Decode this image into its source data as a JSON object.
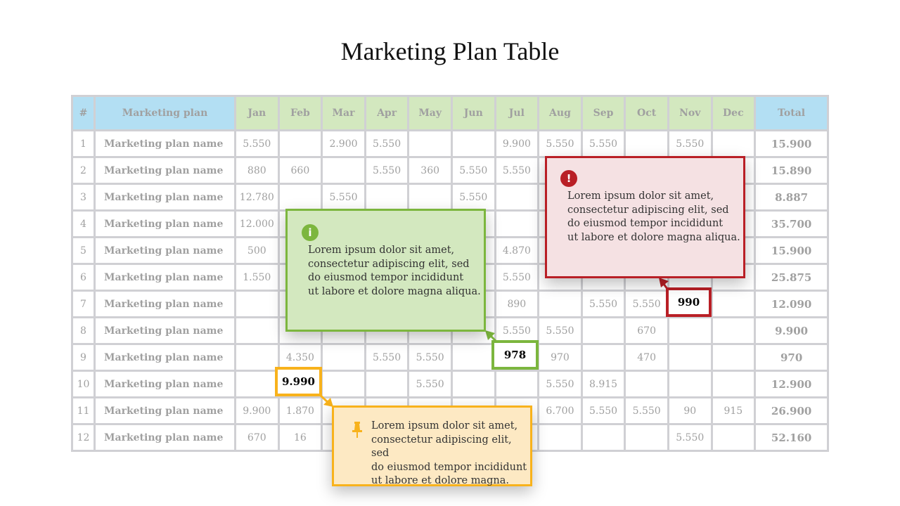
{
  "title": "Marketing Plan Table",
  "table": {
    "headers": [
      "#",
      "Marketing plan",
      "Jan",
      "Feb",
      "Mar",
      "Apr",
      "May",
      "Jun",
      "Jul",
      "Aug",
      "Sep",
      "Oct",
      "Nov",
      "Dec",
      "Total"
    ],
    "rows": [
      [
        "1",
        "Marketing plan name",
        "5.550",
        "",
        "2.900",
        "5.550",
        "",
        "",
        "9.900",
        "5.550",
        "5.550",
        "",
        "5.550",
        "",
        "15.900"
      ],
      [
        "2",
        "Marketing plan name",
        "880",
        "660",
        "",
        "5.550",
        "360",
        "5.550",
        "5.550",
        "",
        "",
        "",
        "",
        "",
        "15.890"
      ],
      [
        "3",
        "Marketing plan name",
        "12.780",
        "",
        "5.550",
        "",
        "",
        "5.550",
        "",
        "",
        "",
        "",
        "",
        "",
        "8.887"
      ],
      [
        "4",
        "Marketing plan name",
        "12.000",
        "",
        "",
        "",
        "",
        "",
        "",
        "",
        "",
        "",
        "",
        "",
        "35.700"
      ],
      [
        "5",
        "Marketing plan name",
        "500",
        "",
        "",
        "",
        "",
        "",
        "4.870",
        "",
        "",
        "",
        "",
        "",
        "15.900"
      ],
      [
        "6",
        "Marketing plan name",
        "1.550",
        "",
        "",
        "",
        "",
        "",
        "5.550",
        "",
        "",
        "",
        "",
        "",
        "25.875"
      ],
      [
        "7",
        "Marketing plan name",
        "",
        "",
        "",
        "",
        "",
        "",
        "890",
        "",
        "5.550",
        "5.550",
        "990",
        "",
        "12.090"
      ],
      [
        "8",
        "Marketing plan name",
        "",
        "",
        "",
        "",
        "",
        "",
        "5.550",
        "5.550",
        "",
        "670",
        "",
        "",
        "9.900"
      ],
      [
        "9",
        "Marketing plan name",
        "",
        "4.350",
        "",
        "5.550",
        "5.550",
        "",
        "978",
        "970",
        "",
        "470",
        "",
        "",
        "970"
      ],
      [
        "10",
        "Marketing plan name",
        "",
        "9.990",
        "",
        "",
        "5.550",
        "",
        "",
        "5.550",
        "8.915",
        "",
        "",
        "",
        "12.900"
      ],
      [
        "11",
        "Marketing plan name",
        "9.900",
        "1.870",
        "",
        "",
        "",
        "",
        "",
        "6.700",
        "5.550",
        "5.550",
        "90",
        "915",
        "26.900"
      ],
      [
        "12",
        "Marketing plan name",
        "670",
        "16",
        "",
        "",
        "",
        "",
        "",
        "",
        "",
        "",
        "5.550",
        "",
        "52.160"
      ]
    ]
  },
  "highlights": {
    "red": "990",
    "green": "978",
    "orange": "9.990"
  },
  "callouts": {
    "green": {
      "icon": "info-icon",
      "text": "Lorem ipsum dolor sit amet,\nconsectetur adipiscing elit, sed\ndo eiusmod tempor incididunt\nut labore et dolore magna aliqua.",
      "color": "#7cb63e",
      "bg": "#d3e8bf"
    },
    "red": {
      "icon": "exclamation-icon",
      "text": "Lorem ipsum dolor sit amet,\nconsectetur adipiscing elit, sed\ndo eiusmod tempor incididunt\nut labore et dolore magna aliqua.",
      "color": "#b91f26",
      "bg": "#f5e1e3"
    },
    "orange": {
      "icon": "pushpin-icon",
      "text": "Lorem ipsum dolor sit amet,\nconsectetur adipiscing elit, sed\ndo eiusmod tempor incididunt\nut labore et dolore magna.",
      "color": "#f8b21c",
      "bg": "#fde9c3"
    }
  }
}
